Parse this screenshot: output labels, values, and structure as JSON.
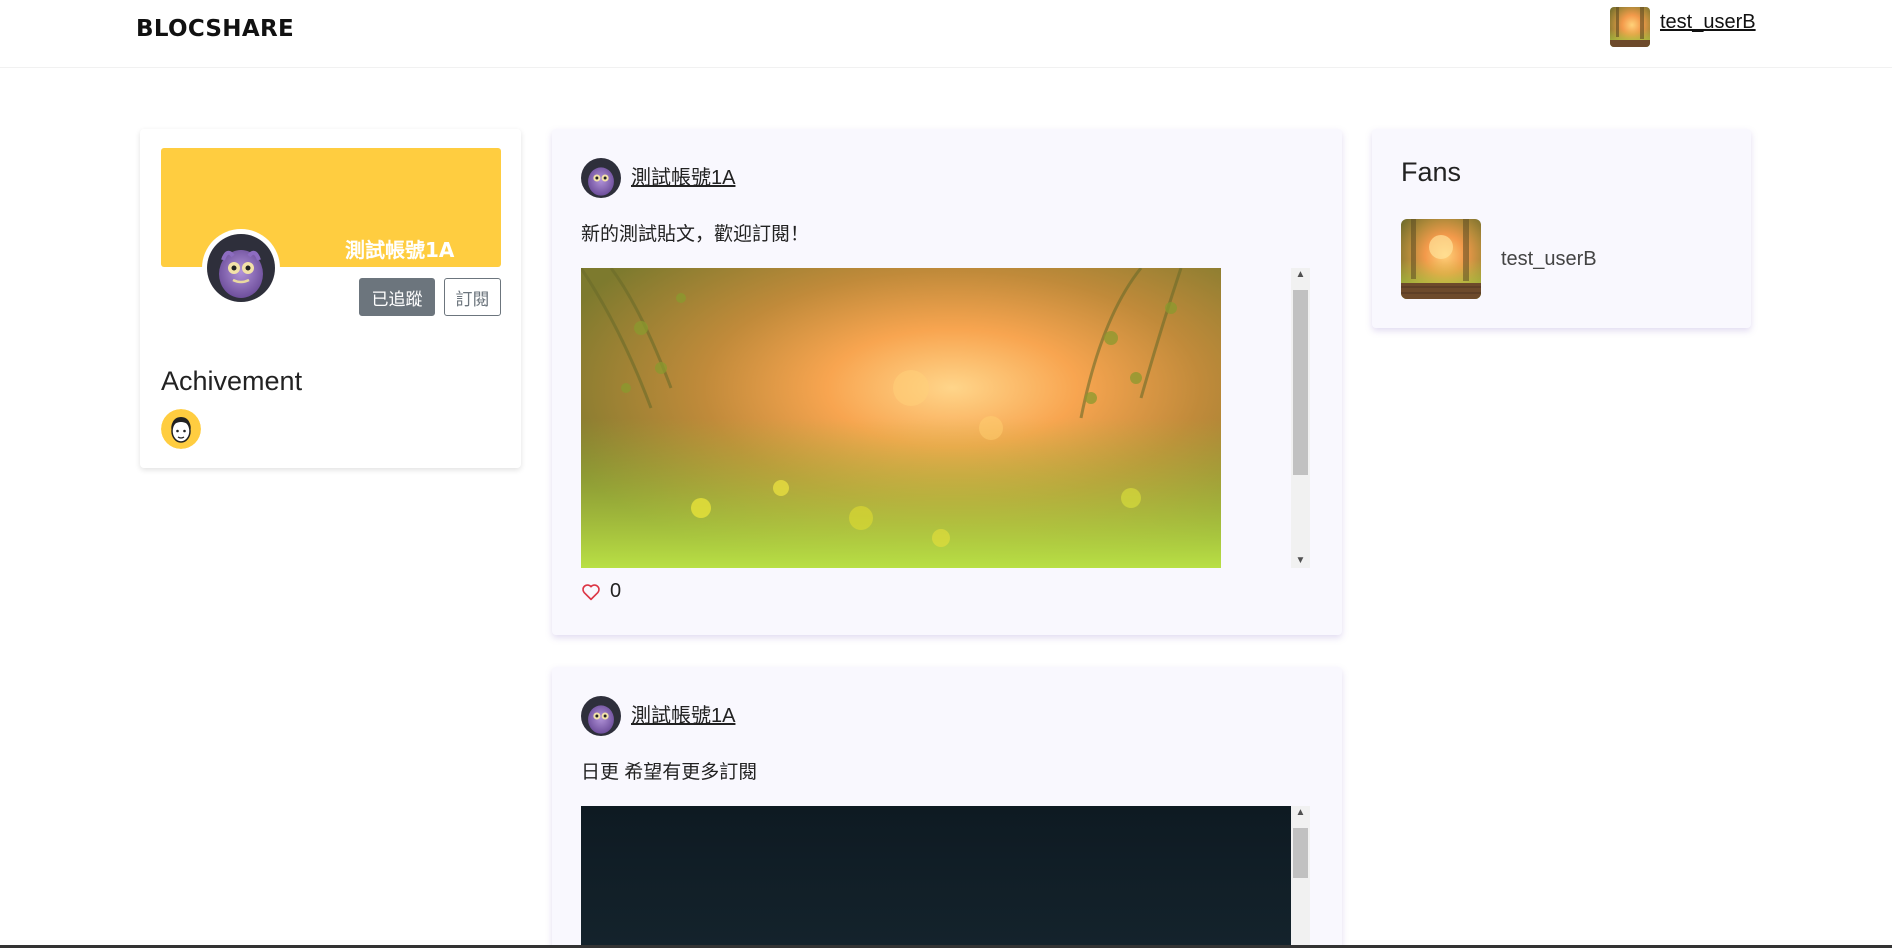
{
  "navbar": {
    "brand": "BLOCSHARE",
    "current_user": "test_userB"
  },
  "profile": {
    "name": "測試帳號1A",
    "followed_label": "已追蹤",
    "subscribe_label": "訂閱",
    "banner_color": "#ffcd40",
    "achievement_title": "Achivement"
  },
  "posts": [
    {
      "author": "測試帳號1A",
      "text": "新的測試貼文，歡迎訂閱！",
      "likes": "0"
    },
    {
      "author": "測試帳號1A",
      "text": "日更 希望有更多訂閱"
    }
  ],
  "fans": {
    "title": "Fans",
    "items": [
      {
        "name": "test_userB"
      }
    ]
  },
  "icons": {
    "like": "heart-outline-icon",
    "scroll_up": "triangle-up",
    "scroll_down": "triangle-down"
  }
}
